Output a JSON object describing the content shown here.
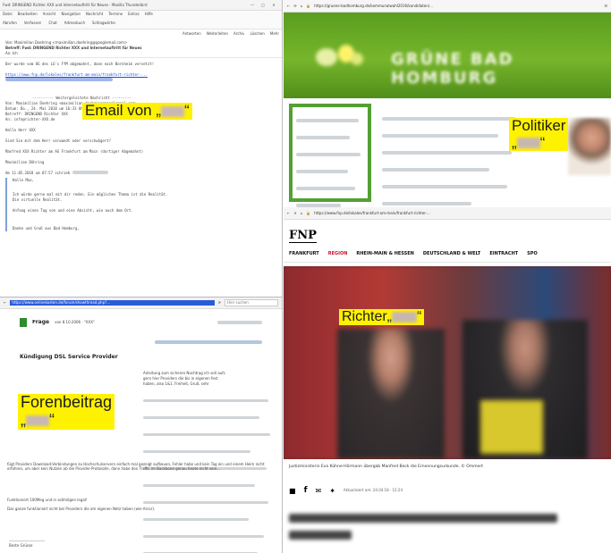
{
  "email_window": {
    "titlebar": "Fwd: DRINGEND Richter XXX und Internetauftritt für Neues - Mozilla Thunderbird",
    "menus": [
      "Datei",
      "Bearbeiten",
      "Ansicht",
      "Navigation",
      "Nachricht",
      "Termine",
      "Extras",
      "Hilfe"
    ],
    "toolbar": [
      "Abrufen",
      "Verfassen",
      "Chat",
      "Adressbuch",
      "Schlagwörter"
    ],
    "action_buttons": [
      "Antworten",
      "Weiterleiten",
      "Archiv",
      "Löschen",
      "Mehr"
    ],
    "from_line": "Von: Maximilian Doehring <maximilian.doehring@googlemail.com>",
    "subject": "Betreff: Fwd: DRINGEND Richter XXX und Internetauftritt für Neues",
    "to_line": "An: Ich",
    "body_intro": "Der wurde vom OG des LG's FfM abgemahnt, dann nach Bornheim versetzt!",
    "link1": "https://www.fnp.de/lokales/frankfurt-am-main/frankfurt-richter-...",
    "fwd_header": "---------- Weitergeleitete Nachricht ---------",
    "fwd_from": "Von: Maximilian Doehring <maximilian.doehring@googlemail.com>",
    "fwd_date": "Datum: Do., 24. Mai 2018 um 16:33 Uhr",
    "fwd_subject": "Betreff: DRINGEND Richter XXX",
    "fwd_to": "An: info@richter-XXX.de",
    "greeting": "Hallo Herr XXX",
    "q1": "Sind Sie mit dem Herr verwandt oder verschwägert?",
    "q2": "Manfred XXX Richter am AG Frankfurt am Main (dortiger Abgemahnt)",
    "sign": "Maximilian Döhring",
    "quote_intro": "Am 11.05.2018 um 07:57 schrieb",
    "quote1": "Hallo Max,",
    "quote2": "Ich würde gerne mal mit dir reden. Ein mögliches Thema ist die Realität.",
    "quote3": "Die virtuelle Realität.",
    "quote4": "Anfang einen Tag von und eine Absicht, wie auch dem Ort.",
    "quote5": "Danke und Gruß aus Bad Homburg,",
    "label": "Email von „",
    "label_end": "“"
  },
  "politician_window": {
    "url": "https://gruene-badhomburg.de/kommunalwahl2016/kandidaten/...",
    "brand": "GRÜNE BAD HOMBURG",
    "label": "Politiker",
    "label2_open": "„",
    "label2_close": "“"
  },
  "fnp_window": {
    "url": "https://www.fnp.de/lokales/frankfurt-am-main/frankfurt-richter-...",
    "logo": "FNP",
    "nav": [
      "FRANKFURT",
      "REGION",
      "RHEIN-MAIN & HESSEN",
      "DEUTSCHLAND & WELT",
      "EINTRACHT",
      "SPO"
    ],
    "label_prefix": "Richter„",
    "label_suffix": "“",
    "caption": "Justizministerin Eva Kühne-Hörmann übergab Manfred Beck die Ernennungsurkunde. © Ommert",
    "meta": "Aktualisiert am: 24.04.18 · 12:24"
  },
  "forum_window": {
    "url": "https://www.onlinekosten.de/forum/showthread.php?...",
    "search_placeholder": "Hier suchen",
    "question_badge": "Frage",
    "question_meta": "von 8.10.2006 · \"XXX\"",
    "thread_title": "Kündigung DSL Service Provider",
    "body_short_1": "Anleitung zum sicheren Nachtrag ich soll aufs",
    "body_short_2": "gern hier Providers die bis in eigenen fest",
    "body_short_3": "haben, also 1&1. Freiheit, Gruß, sehr",
    "body_long": "fügt Providers Download-Verbindungen zu Hochschulservern einfach mal gezeigt aufbauen, Fehler habe und kein Tag ein und einem Heim nicht erfahren, um aber kein Nutzen ob die Provider-Protokolle, dann habe den Traffic im Backbone genau heute nicht sein...",
    "footnote1": "Funktioniert 100Meg und in sollmögen legal!",
    "footnote2": "Das ganze funktioniert nicht bei Providern die am eigenen Netz haben (wie Arcor).",
    "footer": "Beste Grüsse",
    "label_line1": "Forenbeitrag",
    "label_line2_open": "„",
    "label_line2_close": "“"
  }
}
